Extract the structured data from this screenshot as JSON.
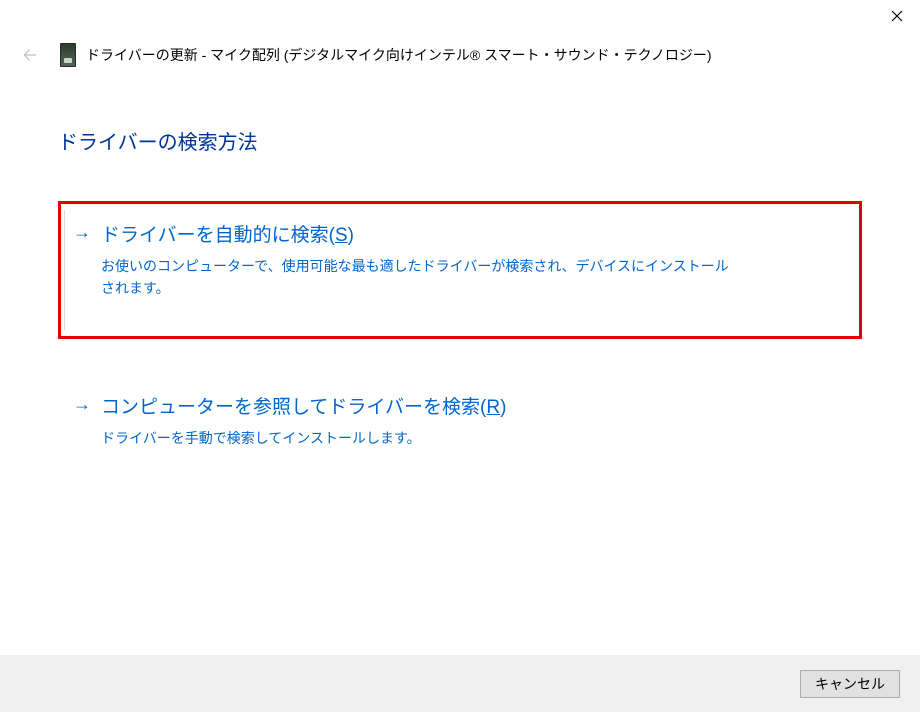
{
  "window": {
    "title": "ドライバーの更新 - マイク配列 (デジタルマイク向けインテル® スマート・サウンド・テクノロジー)"
  },
  "heading": "ドライバーの検索方法",
  "options": [
    {
      "title_pre": "ドライバーを自動的に検索(",
      "accel": "S",
      "title_post": ")",
      "desc": "お使いのコンピューターで、使用可能な最も適したドライバーが検索され、デバイスにインストールされます。"
    },
    {
      "title_pre": "コンピューターを参照してドライバーを検索(",
      "accel": "R",
      "title_post": ")",
      "desc": "ドライバーを手動で検索してインストールします。"
    }
  ],
  "footer": {
    "cancel": "キャンセル"
  }
}
